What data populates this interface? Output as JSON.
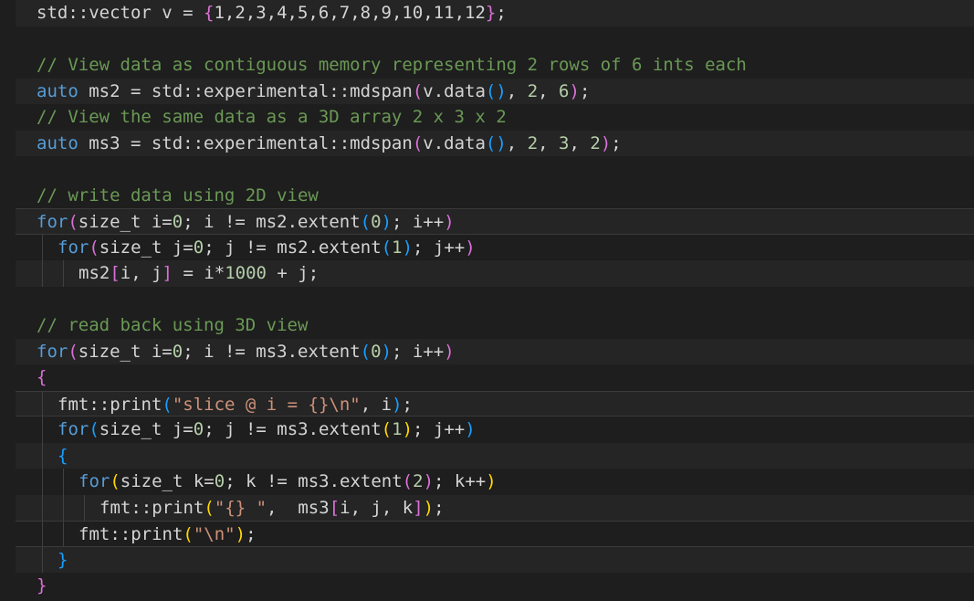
{
  "editor": {
    "lines": [
      {
        "indent": 0,
        "band": true,
        "current": false,
        "tokens": [
          [
            "std::vector v = ",
            "text"
          ],
          [
            "{",
            "b2"
          ],
          [
            "1,2,3,4,5,6,7,8,9,10,11,12",
            "text"
          ],
          [
            "}",
            "b2"
          ],
          [
            ";",
            "text"
          ]
        ]
      },
      {
        "indent": 0,
        "band": false,
        "current": false,
        "tokens": []
      },
      {
        "indent": 0,
        "band": false,
        "current": false,
        "tokens": [
          [
            "// View data as contiguous memory representing 2 rows of 6 ints each",
            "cmt"
          ]
        ]
      },
      {
        "indent": 0,
        "band": true,
        "current": false,
        "tokens": [
          [
            "auto",
            "kw"
          ],
          [
            " ms2 = std::experimental::mdspan",
            "text"
          ],
          [
            "(",
            "b2"
          ],
          [
            "v.data",
            "text"
          ],
          [
            "()",
            "b3"
          ],
          [
            ", ",
            "text"
          ],
          [
            "2",
            "num"
          ],
          [
            ", ",
            "text"
          ],
          [
            "6",
            "num"
          ],
          [
            ")",
            "b2"
          ],
          [
            ";",
            "text"
          ]
        ]
      },
      {
        "indent": 0,
        "band": false,
        "current": false,
        "tokens": [
          [
            "// View the same data as a 3D array 2 x 3 x 2",
            "cmt"
          ]
        ]
      },
      {
        "indent": 0,
        "band": true,
        "current": false,
        "tokens": [
          [
            "auto",
            "kw"
          ],
          [
            " ms3 = std::experimental::mdspan",
            "text"
          ],
          [
            "(",
            "b2"
          ],
          [
            "v.data",
            "text"
          ],
          [
            "()",
            "b3"
          ],
          [
            ", ",
            "text"
          ],
          [
            "2",
            "num"
          ],
          [
            ", ",
            "text"
          ],
          [
            "3",
            "num"
          ],
          [
            ", ",
            "text"
          ],
          [
            "2",
            "num"
          ],
          [
            ")",
            "b2"
          ],
          [
            ";",
            "text"
          ]
        ]
      },
      {
        "indent": 0,
        "band": false,
        "current": false,
        "tokens": []
      },
      {
        "indent": 0,
        "band": false,
        "current": false,
        "tokens": [
          [
            "// write data using 2D view",
            "cmt"
          ]
        ]
      },
      {
        "indent": 0,
        "band": true,
        "current": true,
        "tokens": [
          [
            "for",
            "ctrl"
          ],
          [
            "(",
            "b2"
          ],
          [
            "size_t i=",
            "text"
          ],
          [
            "0",
            "num"
          ],
          [
            "; i != ms2.extent",
            "text"
          ],
          [
            "(",
            "b3"
          ],
          [
            "0",
            "num"
          ],
          [
            ")",
            "b3"
          ],
          [
            "; i++",
            "text"
          ],
          [
            ")",
            "b2"
          ]
        ]
      },
      {
        "indent": 1,
        "band": false,
        "current": false,
        "tokens": [
          [
            "for",
            "ctrl"
          ],
          [
            "(",
            "b2"
          ],
          [
            "size_t j=",
            "text"
          ],
          [
            "0",
            "num"
          ],
          [
            "; j != ms2.extent",
            "text"
          ],
          [
            "(",
            "b3"
          ],
          [
            "1",
            "num"
          ],
          [
            ")",
            "b3"
          ],
          [
            "; j++",
            "text"
          ],
          [
            ")",
            "b2"
          ]
        ]
      },
      {
        "indent": 2,
        "band": true,
        "current": false,
        "tokens": [
          [
            "ms2",
            "text"
          ],
          [
            "[",
            "b2"
          ],
          [
            "i, j",
            "text"
          ],
          [
            "]",
            "b2"
          ],
          [
            " = i*",
            "text"
          ],
          [
            "1000",
            "num"
          ],
          [
            " + j;",
            "text"
          ]
        ]
      },
      {
        "indent": 0,
        "band": false,
        "current": false,
        "tokens": []
      },
      {
        "indent": 0,
        "band": false,
        "current": false,
        "tokens": [
          [
            "// read back using 3D view",
            "cmt"
          ]
        ]
      },
      {
        "indent": 0,
        "band": true,
        "current": false,
        "tokens": [
          [
            "for",
            "ctrl"
          ],
          [
            "(",
            "b2"
          ],
          [
            "size_t i=",
            "text"
          ],
          [
            "0",
            "num"
          ],
          [
            "; i != ms3.extent",
            "text"
          ],
          [
            "(",
            "b3"
          ],
          [
            "0",
            "num"
          ],
          [
            ")",
            "b3"
          ],
          [
            "; i++",
            "text"
          ],
          [
            ")",
            "b2"
          ]
        ]
      },
      {
        "indent": 0,
        "band": false,
        "current": false,
        "tokens": [
          [
            "{",
            "b2"
          ]
        ]
      },
      {
        "indent": 1,
        "band": true,
        "current": true,
        "tokens": [
          [
            "fmt::print",
            "text"
          ],
          [
            "(",
            "b3"
          ],
          [
            "\"slice @ i = {}\\n\"",
            "str"
          ],
          [
            ", i",
            "text"
          ],
          [
            ")",
            "b3"
          ],
          [
            ";",
            "text"
          ]
        ]
      },
      {
        "indent": 1,
        "band": false,
        "current": false,
        "tokens": [
          [
            "for",
            "ctrl"
          ],
          [
            "(",
            "b3"
          ],
          [
            "size_t j=",
            "text"
          ],
          [
            "0",
            "num"
          ],
          [
            "; j != ms3.extent",
            "text"
          ],
          [
            "(",
            "b1"
          ],
          [
            "1",
            "num"
          ],
          [
            ")",
            "b1"
          ],
          [
            "; j++",
            "text"
          ],
          [
            ")",
            "b3"
          ]
        ]
      },
      {
        "indent": 1,
        "band": true,
        "current": false,
        "tokens": [
          [
            "{",
            "b3"
          ]
        ]
      },
      {
        "indent": 2,
        "band": false,
        "current": false,
        "tokens": [
          [
            "for",
            "ctrl"
          ],
          [
            "(",
            "b1"
          ],
          [
            "size_t k=",
            "text"
          ],
          [
            "0",
            "num"
          ],
          [
            "; k != ms3.extent",
            "text"
          ],
          [
            "(",
            "b2"
          ],
          [
            "2",
            "num"
          ],
          [
            ")",
            "b2"
          ],
          [
            "; k++",
            "text"
          ],
          [
            ")",
            "b1"
          ]
        ]
      },
      {
        "indent": 3,
        "band": true,
        "current": false,
        "tokens": [
          [
            "fmt::print",
            "text"
          ],
          [
            "(",
            "b1"
          ],
          [
            "\"{} \"",
            "str"
          ],
          [
            ",  ms3",
            "text"
          ],
          [
            "[",
            "b2"
          ],
          [
            "i, j, k",
            "text"
          ],
          [
            "]",
            "b2"
          ],
          [
            ")",
            "b1"
          ],
          [
            ";",
            "text"
          ]
        ]
      },
      {
        "indent": 2,
        "band": false,
        "current": true,
        "tokens": [
          [
            "fmt::print",
            "text"
          ],
          [
            "(",
            "b1"
          ],
          [
            "\"\\n\"",
            "str"
          ],
          [
            ")",
            "b1"
          ],
          [
            ";",
            "text"
          ]
        ]
      },
      {
        "indent": 1,
        "band": true,
        "current": false,
        "tokens": [
          [
            "}",
            "b3"
          ]
        ]
      },
      {
        "indent": 0,
        "band": false,
        "current": false,
        "tokens": [
          [
            "}",
            "b2"
          ]
        ]
      }
    ]
  }
}
